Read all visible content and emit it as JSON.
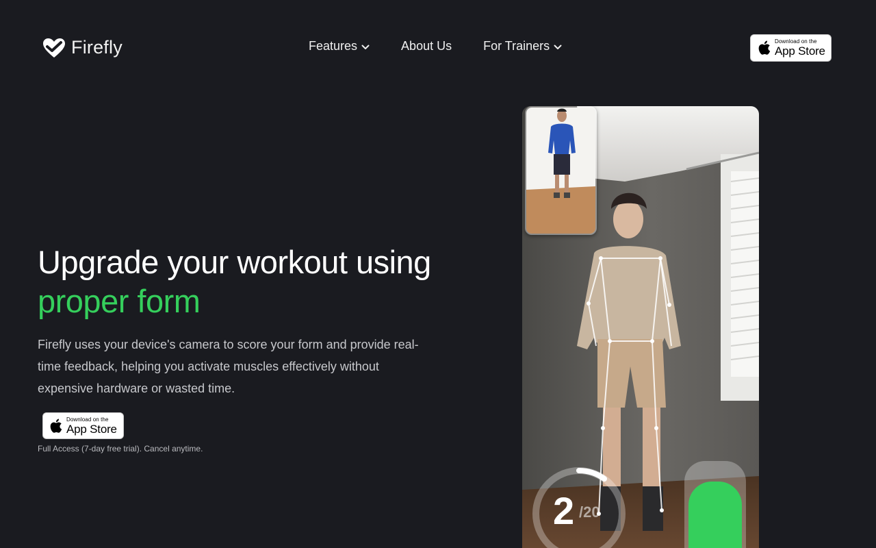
{
  "brand": {
    "name": "Firefly"
  },
  "nav": {
    "items": [
      {
        "label": "Features",
        "has_dropdown": true
      },
      {
        "label": "About Us",
        "has_dropdown": false
      },
      {
        "label": "For Trainers",
        "has_dropdown": true
      }
    ]
  },
  "app_store_badge": {
    "small": "Download on the",
    "big": "App Store"
  },
  "hero": {
    "title_line1": "Upgrade your workout using",
    "title_accent": "proper form",
    "description": "Firefly uses your device's camera to score your form and provide real-time feedback, helping you activate muscles effectively without expensive hardware or wasted time.",
    "trial_note": "Full Access (7-day free trial). Cancel anytime."
  },
  "workout_demo": {
    "rep_count": "2",
    "rep_total": "/20",
    "progress": 0.1
  },
  "colors": {
    "background": "#1a1b20",
    "accent": "#35cf5c",
    "text_primary": "#ffffff",
    "text_secondary": "#c7c8cc"
  },
  "icons": {
    "logo": "heart-check-icon",
    "dropdown": "chevron-down-icon",
    "store": "apple-icon"
  }
}
